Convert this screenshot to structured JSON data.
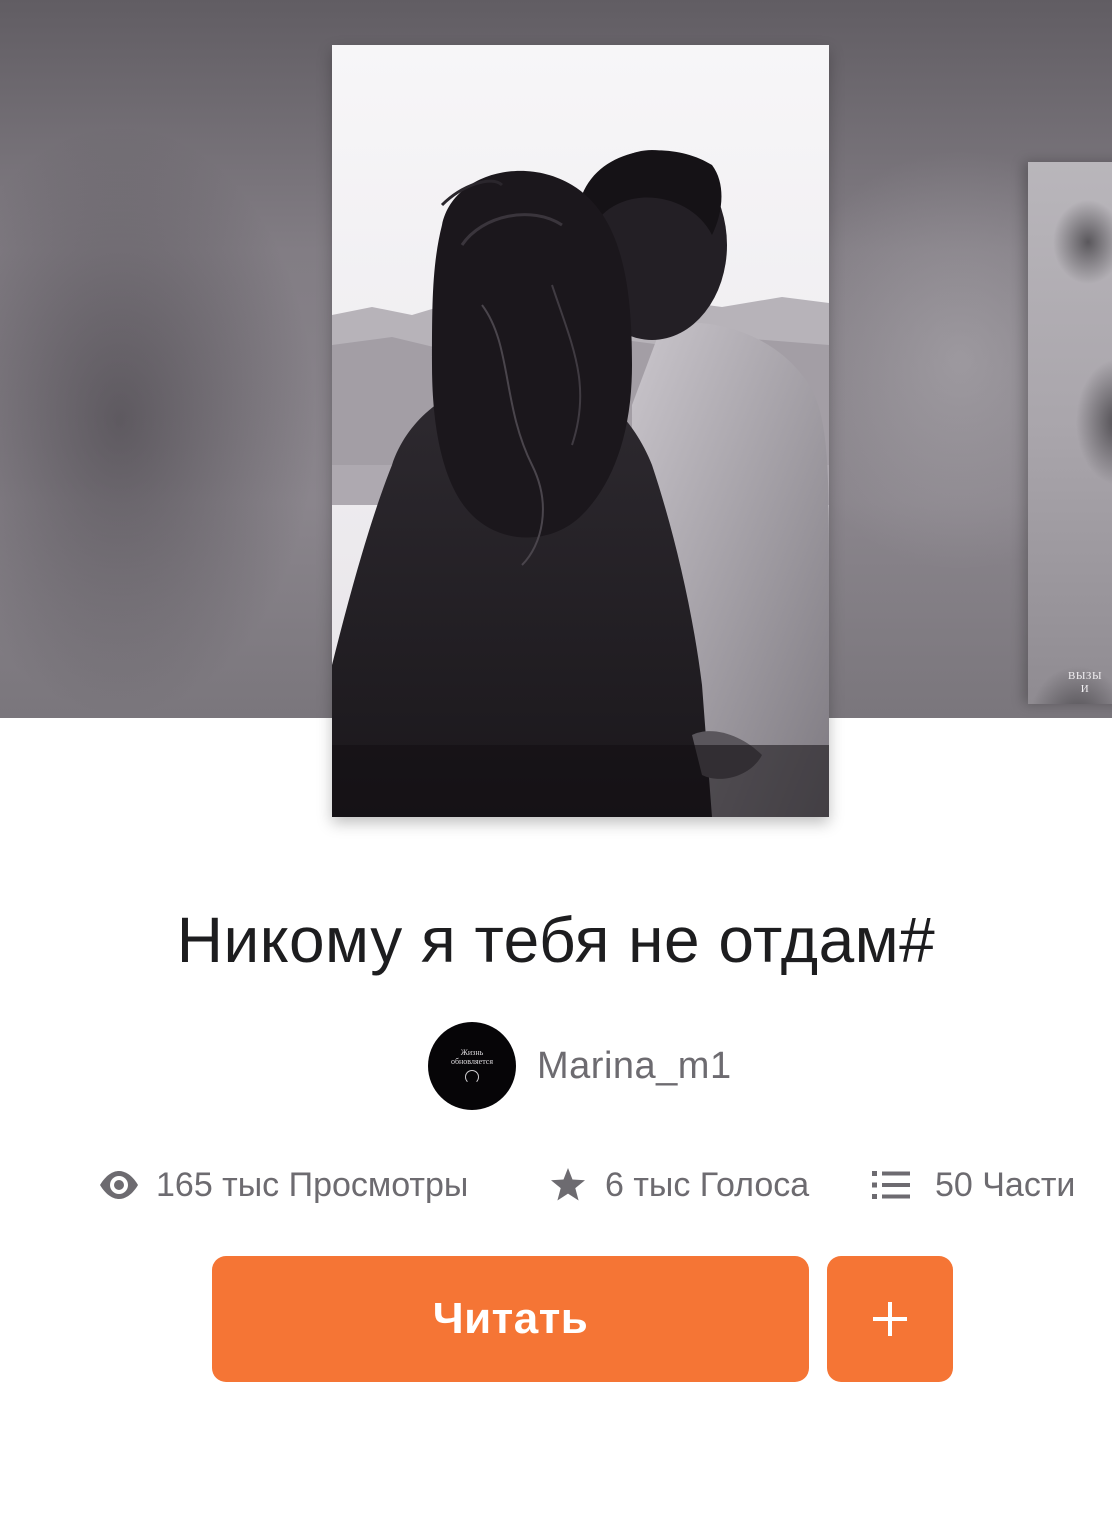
{
  "story": {
    "title": "Никому я тебя не отдам#",
    "cover_alt": "Обложка истории"
  },
  "side_cover": {
    "text_line1": "ВЫЗЫ",
    "text_line2": "И"
  },
  "author": {
    "name": "Marina_m1",
    "avatar_line1": "Жизнь",
    "avatar_line2": "обновляется"
  },
  "stats": {
    "views": "165 тыс Просмотры",
    "votes": "6 тыс Голоса",
    "parts": "50 Части"
  },
  "actions": {
    "read_label": "Читать",
    "add_label": "+"
  },
  "icons": {
    "views": "eye-icon",
    "votes": "star-icon",
    "parts": "list-icon",
    "add": "plus-icon"
  },
  "colors": {
    "accent": "#f57535",
    "title": "#1d1d1f",
    "secondary_text": "#6d6b70"
  }
}
